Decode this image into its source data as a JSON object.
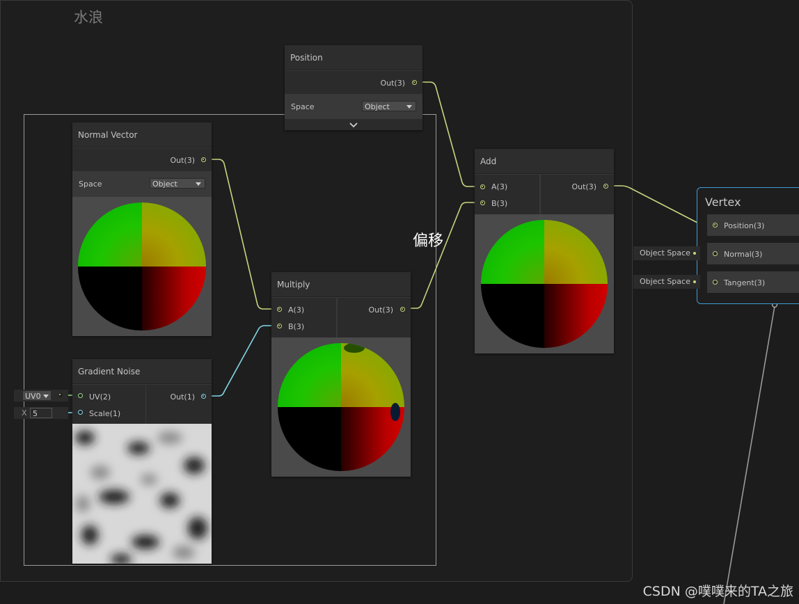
{
  "group": {
    "title": "水浪"
  },
  "annotation": "偏移",
  "nodes": {
    "position": {
      "title": "Position",
      "out_label": "Out(3)",
      "space_label": "Space",
      "space_value": "Object"
    },
    "normal_vector": {
      "title": "Normal Vector",
      "out_label": "Out(3)",
      "space_label": "Space",
      "space_value": "Object"
    },
    "gradient_noise": {
      "title": "Gradient Noise",
      "uv_label": "UV(2)",
      "scale_label": "Scale(1)",
      "out_label": "Out(1)"
    },
    "multiply": {
      "title": "Multiply",
      "a_label": "A(3)",
      "b_label": "B(3)",
      "out_label": "Out(3)"
    },
    "add": {
      "title": "Add",
      "a_label": "A(3)",
      "b_label": "B(3)",
      "out_label": "Out(3)"
    },
    "vertex": {
      "title": "Vertex",
      "position_label": "Position(3)",
      "normal_label": "Normal(3)",
      "tangent_label": "Tangent(3)",
      "normal_space": "Object Space",
      "tangent_space": "Object Space"
    }
  },
  "inputs": {
    "uv_channel": "UV0",
    "scale_axis": "X",
    "scale_value": "5"
  },
  "wire_colors": {
    "vector3": "#c8d480",
    "vector1": "#84d7e8",
    "vector2": "#9bdc8a",
    "selection": "#9a9a9a",
    "vertex_border": "#3d9bd6"
  },
  "watermark": "CSDN @噗噗来的TA之旅"
}
